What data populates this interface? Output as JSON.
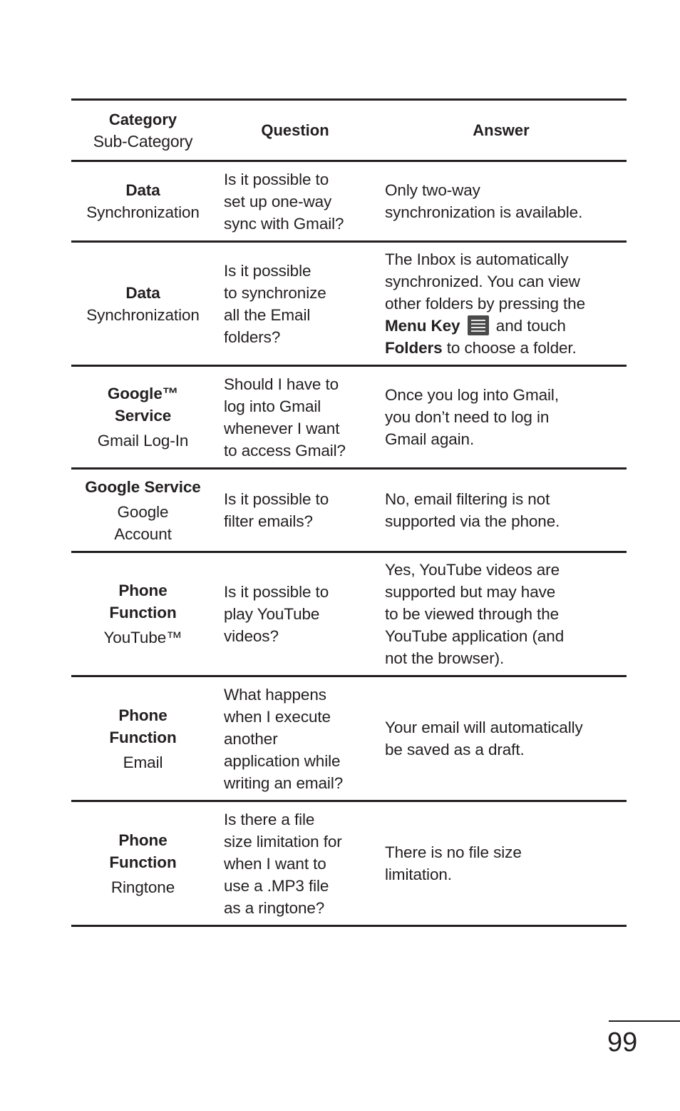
{
  "table": {
    "header": {
      "category": "Category",
      "sub_category": "Sub-Category",
      "question": "Question",
      "answer": "Answer"
    },
    "rows": [
      {
        "category": "Data",
        "sub_category": "Synchronization",
        "question": "Is it possible to\nset up one-way\nsync with Gmail?",
        "answer": "Only two-way\nsynchronization is available."
      },
      {
        "category": "Data",
        "sub_category": "Synchronization",
        "question": "Is it possible\nto synchronize\nall the Email\nfolders?",
        "answer_parts": {
          "intro": "The Inbox is automatically\nsynchronized. You can view\nother folders by pressing the",
          "menu_key": "Menu Key",
          "menu_icon": "menu-icon",
          "and_touch": "and touch",
          "folders": "Folders",
          "outro": "to choose a folder."
        }
      },
      {
        "category": "Google™\nService",
        "sub_category": "Gmail Log-In",
        "question": "Should I have to\nlog into Gmail\nwhenever I want\nto access Gmail?",
        "answer": "Once you log into Gmail,\nyou don’t need to log in\nGmail again."
      },
      {
        "category": "Google Service",
        "sub_category": "Google\nAccount",
        "question": "Is it possible to\nfilter emails?",
        "answer": "No, email filtering is not\nsupported via the phone."
      },
      {
        "category": "Phone\nFunction",
        "sub_category": "YouTube™",
        "question": "Is it possible to\nplay YouTube\nvideos?",
        "answer": "Yes, YouTube videos are\nsupported but may have\nto be viewed through the\nYouTube application (and\nnot the browser)."
      },
      {
        "category": "Phone\nFunction",
        "sub_category": "Email",
        "question": "What happens\nwhen I execute\nanother\napplication while\nwriting an email?",
        "answer": "Your email will automatically\nbe saved as a draft."
      },
      {
        "category": "Phone\nFunction",
        "sub_category": "Ringtone",
        "question": "Is there a file\nsize limitation for\nwhen I want to\nuse a .MP3 file\nas a ringtone?",
        "answer": "There is no file size\nlimitation."
      }
    ]
  },
  "page": {
    "number": "99"
  }
}
